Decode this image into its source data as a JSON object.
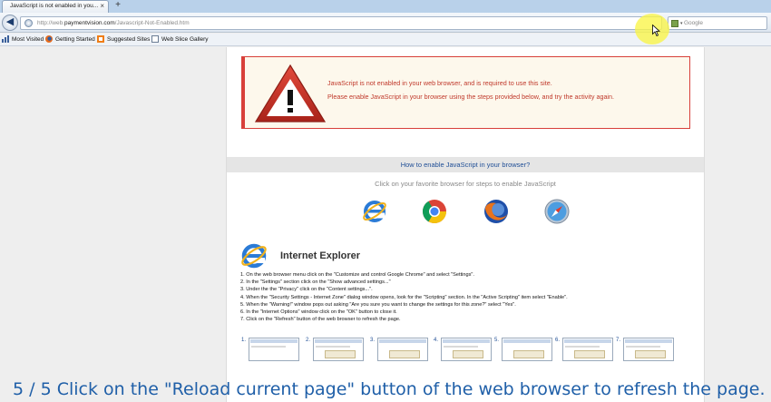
{
  "browser": {
    "tab_title": "JavaScript is not enabled in you...",
    "tab_close": "×",
    "new_tab": "+",
    "url_prefix": "http://web.",
    "url_domain": "paymentvision.com",
    "url_path": "/Javascript-Not-Enabled.htm",
    "reload_glyph": "↻",
    "search_placeholder": "Google",
    "search_caret": "▾",
    "bookmarks": [
      {
        "label": "Most Visited",
        "icon": "most-visited-icon"
      },
      {
        "label": "Getting Started",
        "icon": "firefox-icon"
      },
      {
        "label": "Suggested Sites",
        "icon": "suggested-sites-icon"
      },
      {
        "label": "Web Slice Gallery",
        "icon": "web-slice-icon"
      }
    ]
  },
  "alert": {
    "icon": "warning-triangle-icon",
    "line1": "JavaScript is not enabled in your web browser, and is required to use this site.",
    "line2": "Please enable JavaScript in your browser using the steps provided below, and try the activity again."
  },
  "howto": {
    "heading": "How to enable JavaScript in your browser?",
    "subheading": "Click on your favorite browser for steps to enable JavaScript",
    "browsers": [
      "internet-explorer-icon",
      "chrome-icon",
      "firefox-icon",
      "safari-icon"
    ]
  },
  "ie_section": {
    "title": "Internet Explorer",
    "steps": [
      "1.  On the web browser menu click on the \"Customize and control Google Chrome\" and select \"Settings\".",
      "2.  In the \"Settings\" section click on the \"Show advanced settings...\"",
      "3.  Under the the \"Privacy\" click on the \"Content settings...\".",
      "4.  When the \"Security Settings - Internet Zone\" dialog window opens, look for the \"Scripting\" section. In the \"Active Scripting\" item select \"Enable\".",
      "5.  When the \"Warning!\" window pops out asking \"Are you sure you want to change the settings for this zone?\" select \"Yes\".",
      "6.  In the \"Internet Options\" window click on the \"OK\" button to close it.",
      "7.  Click on the \"Refresh\" button of the web browser to refresh the page."
    ],
    "thumb_numbers": [
      "1.",
      "2.",
      "3.",
      "4.",
      "5.",
      "6.",
      "7."
    ]
  },
  "caption": "5 / 5   Click on the \"Reload current page\" button of the web browser to refresh the page.",
  "colors": {
    "alert_border": "#d8403a",
    "alert_text": "#c0392b",
    "link_blue": "#1f4e96",
    "caption_blue": "#1f5fa8",
    "highlight": "#faf546"
  }
}
